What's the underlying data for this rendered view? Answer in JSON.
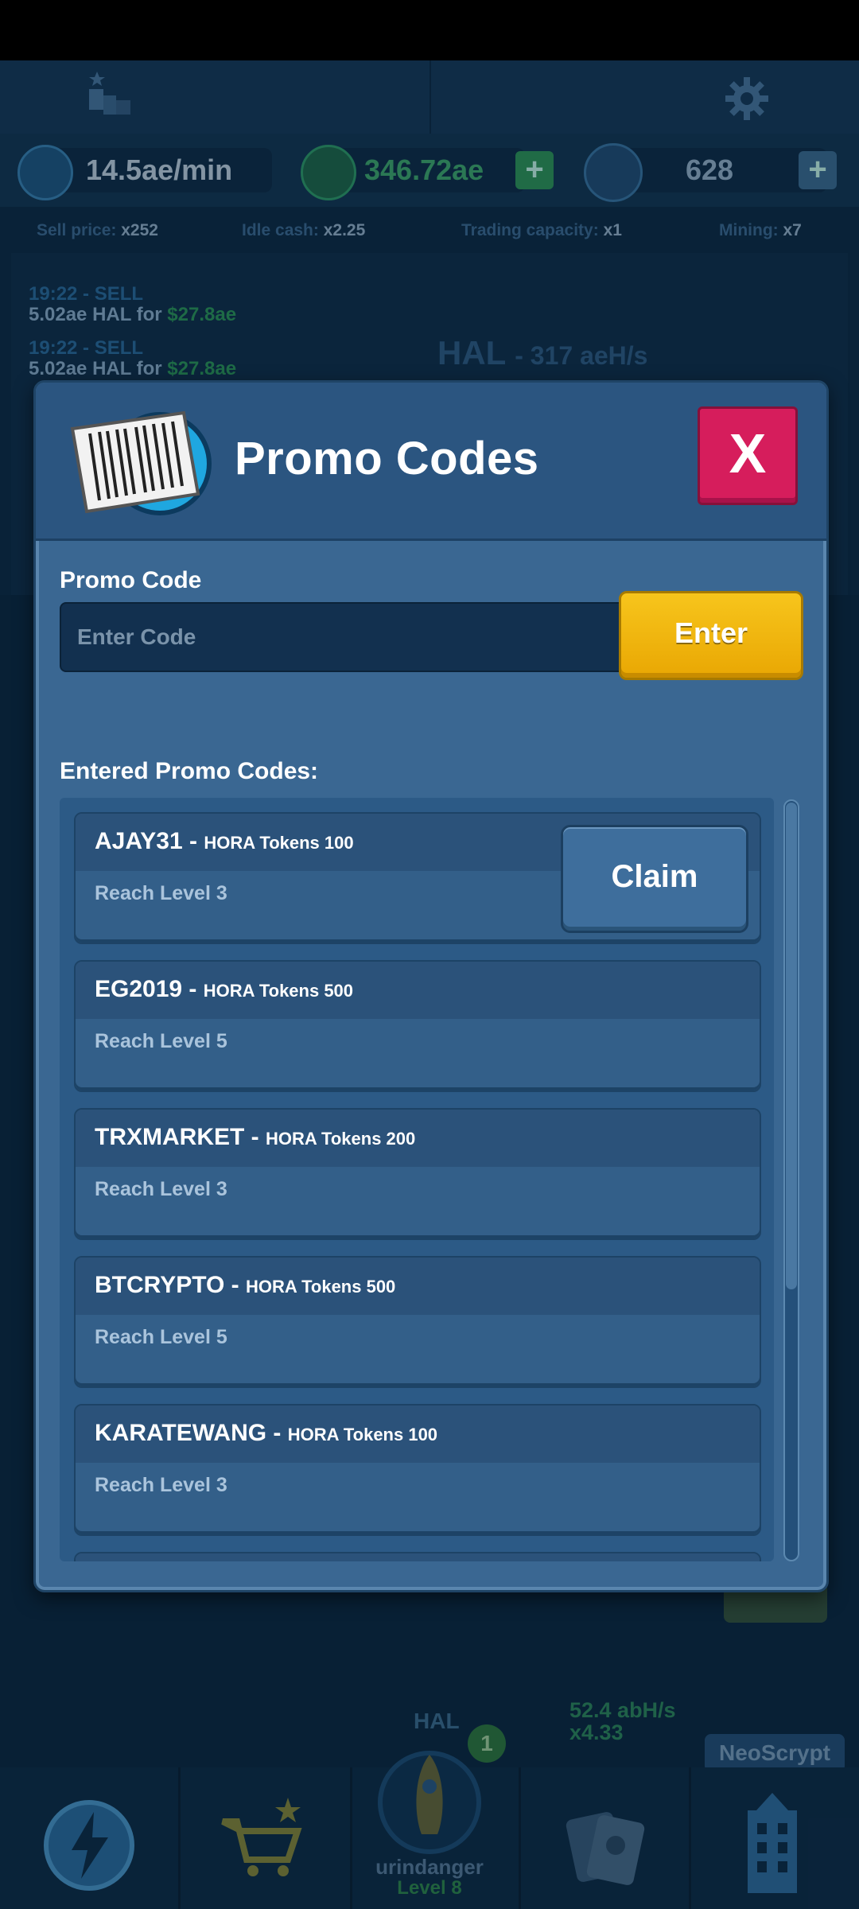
{
  "background": {
    "income_rate": "14.5ae/min",
    "balance": "346.72ae",
    "tokens": "628",
    "stats": {
      "sell_price_label": "Sell price:",
      "sell_price_value": "x252",
      "idle_cash_label": "Idle cash:",
      "idle_cash_value": "x2.25",
      "trading_label": "Trading capacity:",
      "trading_value": "x1",
      "mining_label": "Mining:",
      "mining_value": "x7"
    },
    "log": [
      {
        "time": "19:22 - SELL",
        "desc_prefix": "5.02ae HAL for ",
        "amount": "$27.8ae"
      },
      {
        "time": "19:22 - SELL",
        "desc_prefix": "5.02ae HAL for ",
        "amount": "$27.8ae"
      }
    ],
    "hal_rate_name": "HAL",
    "hal_rate_value": "- 317 aeH/s",
    "hal_label": "HAL",
    "hashrate_line1": "52.4 abH/s",
    "hashrate_line2": "x4.33",
    "badge_count": "1",
    "algorithm": "NeoScrypt",
    "username": "urindanger",
    "user_level": "Level 8"
  },
  "modal": {
    "title": "Promo Codes",
    "close_label": "X",
    "input_label": "Promo Code",
    "input_placeholder": "Enter Code",
    "enter_label": "Enter",
    "entered_label": "Entered Promo Codes:",
    "claim_label": "Claim",
    "codes": [
      {
        "code": "AJAY31 - ",
        "reward": "HORA Tokens 100",
        "requirement": "Reach Level 3"
      },
      {
        "code": "EG2019 - ",
        "reward": "HORA Tokens 500",
        "requirement": "Reach Level 5"
      },
      {
        "code": "TRXMARKET - ",
        "reward": "HORA Tokens 200",
        "requirement": "Reach Level 3"
      },
      {
        "code": "BTCRYPTO - ",
        "reward": "HORA Tokens 500",
        "requirement": "Reach Level 5"
      },
      {
        "code": "KARATEWANG - ",
        "reward": "HORA Tokens 100",
        "requirement": "Reach Level 3"
      }
    ]
  }
}
